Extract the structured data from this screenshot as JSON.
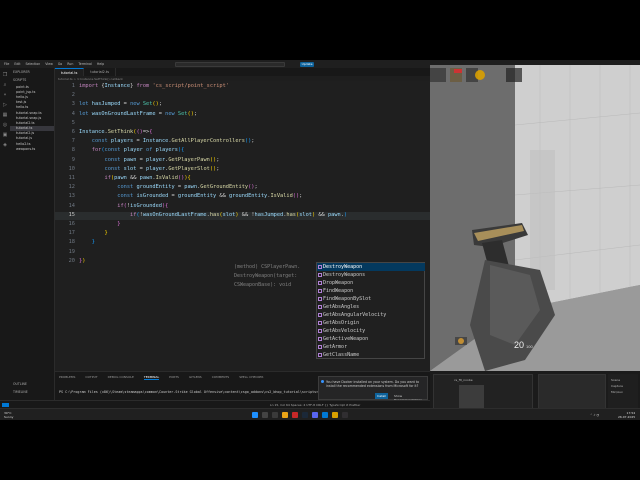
{
  "vscode": {
    "menu": [
      "File",
      "Edit",
      "Selection",
      "View",
      "Go",
      "Run",
      "Terminal",
      "Help"
    ],
    "accounts_button": "Update",
    "explorer_title": "EXPLORER",
    "explorer_section": "SCRIPTS",
    "files": [
      "point.ts",
      "point_jsp.ts",
      "hello.js",
      "test.js",
      "hello.ts",
      "tutorial.snap.ts",
      "tutorial.snap.js",
      "tutorial2.ts",
      "tutorial.ts",
      "tutorial2.js",
      "tutorial.js",
      "hello2.ts",
      "weapons.ts"
    ],
    "active_file": "tutorial.ts",
    "outline_label": "OUTLINE",
    "timeline_label": "TIMELINE",
    "tabs": [
      {
        "label": "tutorial.ts",
        "active": true
      },
      {
        "label": "tutorial2.ts",
        "active": false
      }
    ],
    "breadcrumb": "tutorial.ts > ⊙ Instance.SetThink() callback",
    "code_lines": [
      {
        "n": "1",
        "html": "<span class='kw'>import</span> <span class='pun'>{</span><span class='var'>Instance</span><span class='pun'>}</span> <span class='kw'>from</span> <span class='str'>'cs_script/point_script'</span>"
      },
      {
        "n": "2",
        "html": ""
      },
      {
        "n": "3",
        "html": "<span class='dec'>let</span> <span class='var'>hasJumped</span> = <span class='dec'>new</span> <span class='cls'>Set</span><span class='br1'>(</span><span class='br1'>)</span>;"
      },
      {
        "n": "4",
        "html": "<span class='dec'>let</span> <span class='var'>wasOnGroundLastFrame</span> = <span class='dec'>new</span> <span class='cls'>Set</span><span class='br1'>(</span><span class='br1'>)</span>;"
      },
      {
        "n": "5",
        "html": ""
      },
      {
        "n": "6",
        "html": "<span class='var'>Instance</span>.<span class='fn'>SetThink</span><span class='br1'>(</span><span class='br2'>()</span>=&gt;<span class='br2'>{</span>"
      },
      {
        "n": "7",
        "html": "    <span class='dec'>const</span> <span class='var'>players</span> = <span class='var'>Instance</span>.<span class='fn'>GetAllPlayerControllers</span><span class='br3'>()</span>;"
      },
      {
        "n": "8",
        "html": "    <span class='kw'>for</span><span class='br3'>(</span><span class='dec'>const</span> <span class='var'>player</span> <span class='dec'>of</span> <span class='var'>players</span><span class='br3'>)</span><span class='br3'>{</span>"
      },
      {
        "n": "9",
        "html": "        <span class='dec'>const</span> <span class='var'>pawn</span> = <span class='var'>player</span>.<span class='fn'>GetPlayerPawn</span><span class='br1'>()</span>;"
      },
      {
        "n": "10",
        "html": "        <span class='dec'>const</span> <span class='var'>slot</span> = <span class='var'>player</span>.<span class='fn'>GetPlayerSlot</span><span class='br1'>()</span>;"
      },
      {
        "n": "11",
        "html": "        <span class='kw'>if</span><span class='br1'>(</span><span class='var'>pawn</span> &amp;&amp; <span class='var'>pawn</span>.<span class='fn'>IsValid</span><span class='br2'>()</span><span class='br1'>)</span><span class='br1'>{</span>"
      },
      {
        "n": "12",
        "html": "            <span class='dec'>const</span> <span class='var'>groundEntity</span> = <span class='var'>pawn</span>.<span class='fn'>GetGroundEntity</span><span class='br2'>()</span>;"
      },
      {
        "n": "13",
        "html": "            <span class='dec'>const</span> <span class='var'>isGrounded</span> = <span class='var'>groundEntity</span> &amp;&amp; <span class='var'>groundEntity</span>.<span class='fn'>IsValid</span><span class='br2'>()</span>;"
      },
      {
        "n": "14",
        "html": "            <span class='kw'>if</span><span class='br2'>(</span>!<span class='var'>isGrounded</span><span class='br2'>)</span><span class='br2'>{</span>"
      },
      {
        "n": "15",
        "html": "                <span class='kw'>if</span><span class='br3'>(</span>!<span class='var'>wasOnGroundLastFrame</span>.<span class='fn'>has</span><span class='br1'>(</span><span class='var'>slot</span><span class='br1'>)</span> &amp;&amp; !<span class='var'>hasJumped</span>.<span class='fn'>has</span><span class='br1'>(</span><span class='var'>slot</span><span class='br1'>)</span> &amp;&amp; <span class='var'>pawn</span>.<span class='br3'>)</span>"
      },
      {
        "n": "16",
        "html": "            <span class='br2'>}</span>"
      },
      {
        "n": "17",
        "html": "        <span class='br1'>}</span>"
      },
      {
        "n": "18",
        "html": "    <span class='br3'>}</span>"
      },
      {
        "n": "19",
        "html": ""
      },
      {
        "n": "20",
        "html": "<span class='br2'>}</span><span class='br1'>)</span>"
      }
    ],
    "hint_text": "(method) CSPlayerPawn.\nDestroyWeapon(target:\nCSWeaponBase): void",
    "suggestions": [
      "DestroyWeapon",
      "DestroyWeapons",
      "DropWeapon",
      "FindWeapon",
      "FindWeaponBySlot",
      "GetAbsAngles",
      "GetAbsAngularVelocity",
      "GetAbsOrigin",
      "GetAbsVelocity",
      "GetActiveWeapon",
      "GetArmor",
      "GetClassName"
    ],
    "panel_tabs": [
      "PROBLEMS",
      "OUTPUT",
      "DEBUG CONSOLE",
      "TERMINAL",
      "PORTS",
      "GITLENS",
      "COMMENTS",
      "SPELL CHECKER"
    ],
    "panel_active": "TERMINAL",
    "terminal_line": "PS C:\\Program Files (x86)\\Steam\\steamapps\\common\\Counter-Strike Global Offensive\\content\\csgo_addons\\cs2_bhop_tutorial\\scripts>",
    "toast_text": "You have Docker installed on your system. Do you want to install the recommended extensions from Microsoft for it?",
    "toast_install": "Install",
    "toast_show": "Show Recommendations",
    "status_right": "Ln 15, Col 64   Spaces: 4   UTF-8   CRLF   {} TypeScript   ⊘ Prettier"
  },
  "game": {
    "hud_ammo": "20",
    "hud_reserve": "100"
  },
  "obs": {
    "source_label": "cs_fit_noobe",
    "sources": [
      "Scene",
      "Capture",
      "Mic/Aux"
    ]
  },
  "taskbar": {
    "weather_temp": "30°C",
    "weather_text": "Sunny",
    "time": "17:54",
    "date": "26.07.2025"
  },
  "colors": {
    "editor_bg": "#1f1f1f",
    "accent": "#0078d4",
    "suggest_selected": "#04395e"
  }
}
